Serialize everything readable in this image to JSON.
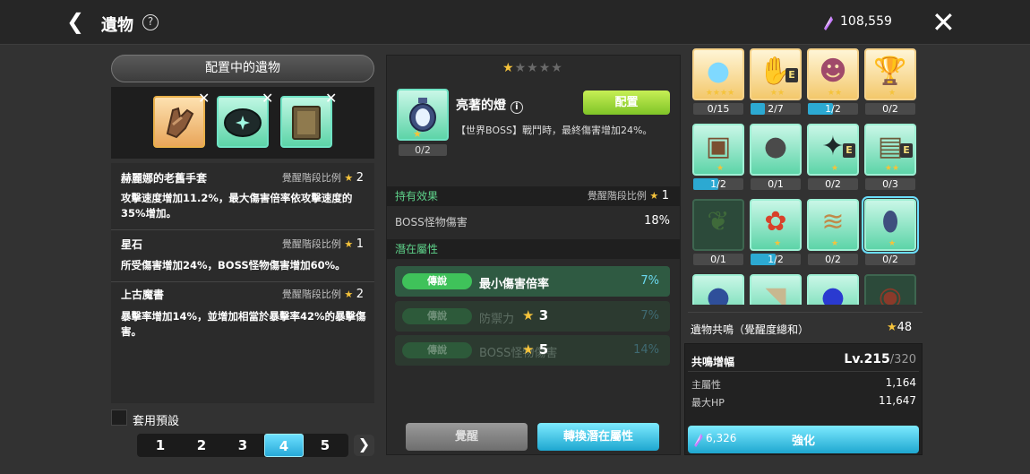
{
  "header": {
    "back_icon": "chevron-left-icon",
    "title": "遺物",
    "help": "?",
    "currency_value": "108,559",
    "currency_icon": "crystal-icon",
    "close_icon": "close-x-icon"
  },
  "equipped": {
    "title": "配置中的遺物",
    "slots": [
      {
        "icon": "glove-icon",
        "color": "gold"
      },
      {
        "icon": "star-stone-icon",
        "color": "green"
      },
      {
        "icon": "ancient-book-icon",
        "color": "green"
      }
    ],
    "relics": [
      {
        "name": "赫麗娜的老舊手套",
        "ratio_label": "覺醒階段比例",
        "ratio": "2",
        "desc": "攻擊速度增加11.2%，最大傷害倍率依攻擊速度的35%增加。"
      },
      {
        "name": "星石",
        "ratio_label": "覺醒階段比例",
        "ratio": "1",
        "desc": "所受傷害增加24%，BOSS怪物傷害增加60%。"
      },
      {
        "name": "上古魔書",
        "ratio_label": "覺醒階段比例",
        "ratio": "2",
        "desc": "暴擊率增加14%，並增加相當於暴擊率42%的暴擊傷害。"
      }
    ],
    "preset_label": "套用預設",
    "pages": [
      "1",
      "2",
      "3",
      "4",
      "5"
    ],
    "active_page": "4",
    "next_icon": "chevron-right-icon"
  },
  "detail": {
    "stars_filled": 1,
    "stars_total": 5,
    "name": "亮著的燈",
    "info_icon": "info-icon",
    "equip_label": "配置",
    "count": "0/2",
    "effect": "【世界BOSS】戰鬥時，最終傷害增加24%。",
    "hold_title": "持有效果",
    "hold_ratio_label": "覺醒階段比例",
    "hold_ratio": "1",
    "hold_stat": "BOSS怪物傷害",
    "hold_value": "18%",
    "potential_title": "潛在屬性",
    "potentials": [
      {
        "grade": "傳說",
        "stat": "最小傷害倍率",
        "value": "7%",
        "locked": false,
        "lock_stars": ""
      },
      {
        "grade": "傳說",
        "stat": "防禦力",
        "value": "7%",
        "locked": true,
        "lock_stars": "3"
      },
      {
        "grade": "傳說",
        "stat": "BOSS怪物傷害",
        "value": "14%",
        "locked": true,
        "lock_stars": "5"
      }
    ],
    "awaken_label": "覺醒",
    "reroll_label": "轉換潛在屬性"
  },
  "grid": [
    {
      "icon": "blue-slime-icon",
      "style": "y",
      "count": "0/15",
      "fill": 0,
      "stars": "★★★★",
      "e": false
    },
    {
      "icon": "glove-icon",
      "style": "y",
      "count": "2/7",
      "fill": 0.29,
      "stars": "★★",
      "e": true
    },
    {
      "icon": "beast-mask-icon",
      "style": "y",
      "count": "1/2",
      "fill": 0.5,
      "stars": "★★",
      "e": false
    },
    {
      "icon": "golden-trophy-icon",
      "style": "y",
      "count": "0/2",
      "fill": 0,
      "stars": "★",
      "e": false
    },
    {
      "icon": "treasure-chest-icon",
      "style": "gr",
      "count": "1/2",
      "fill": 0.5,
      "stars": "★",
      "e": false
    },
    {
      "icon": "dark-disc-icon",
      "style": "gr",
      "count": "0/1",
      "fill": 0,
      "stars": "",
      "e": false
    },
    {
      "icon": "star-stone-icon",
      "style": "gr",
      "count": "0/2",
      "fill": 0,
      "stars": "★",
      "e": true
    },
    {
      "icon": "ancient-book-icon",
      "style": "gr",
      "count": "0/3",
      "fill": 0,
      "stars": "★★",
      "e": true
    },
    {
      "icon": "green-leaf-icon",
      "style": "dk",
      "count": "0/1",
      "fill": 0,
      "stars": "",
      "e": false
    },
    {
      "icon": "red-flower-icon",
      "style": "gr",
      "count": "1/2",
      "fill": 0.5,
      "stars": "★",
      "e": false
    },
    {
      "icon": "scroll-icon",
      "style": "gr",
      "count": "0/2",
      "fill": 0,
      "stars": "★",
      "e": false
    },
    {
      "icon": "lantern-icon",
      "style": "gr",
      "count": "0/2",
      "fill": 0,
      "stars": "★",
      "e": false
    },
    {
      "icon": "blue-bag-icon",
      "style": "gr",
      "count": "",
      "fill": 0,
      "stars": "",
      "e": false
    },
    {
      "icon": "horn-icon",
      "style": "gr",
      "count": "",
      "fill": 0,
      "stars": "",
      "e": false
    },
    {
      "icon": "blue-orb-icon",
      "style": "gr",
      "count": "",
      "fill": 0,
      "stars": "",
      "e": false
    },
    {
      "icon": "red-jar-icon",
      "style": "dk",
      "count": "",
      "fill": 0,
      "stars": "",
      "e": false
    }
  ],
  "resonance": {
    "title": "遺物共鳴（覺醒度總和）",
    "total": "48",
    "boost_label": "共鳴增幅",
    "level": "Lv.215",
    "level_max": "/320",
    "stats": [
      {
        "label": "主屬性",
        "value": "1,164"
      },
      {
        "label": "最大HP",
        "value": "11,647"
      }
    ],
    "cost": "6,326",
    "upgrade_label": "強化"
  }
}
